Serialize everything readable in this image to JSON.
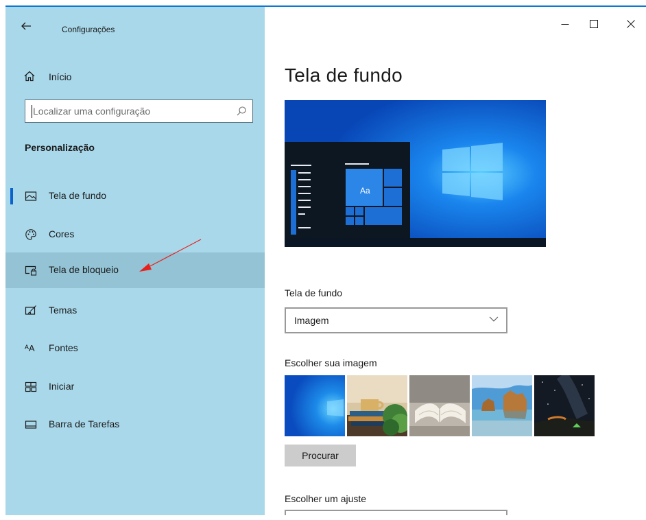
{
  "window": {
    "title": "Configurações",
    "controls": {
      "minimize": "—",
      "maximize": "☐",
      "close": "✕"
    }
  },
  "sidebar": {
    "back_icon": "arrow-left-icon",
    "home": {
      "label": "Início",
      "icon": "home-icon"
    },
    "search": {
      "placeholder": "Localizar uma configuração",
      "icon": "search-icon"
    },
    "section": "Personalização",
    "items": [
      {
        "label": "Tela de fundo",
        "icon": "picture-icon",
        "selected": true
      },
      {
        "label": "Cores",
        "icon": "palette-icon"
      },
      {
        "label": "Tela de bloqueio",
        "icon": "lock-screen-icon",
        "hover": true
      },
      {
        "label": "Temas",
        "icon": "brush-icon"
      },
      {
        "label": "Fontes",
        "icon": "font-icon",
        "glyph": "ᴬA"
      },
      {
        "label": "Iniciar",
        "icon": "start-icon"
      },
      {
        "label": "Barra de Tarefas",
        "icon": "taskbar-icon"
      }
    ]
  },
  "main": {
    "title": "Tela de fundo",
    "preview_tile_text": "Aa",
    "background_label": "Tela de fundo",
    "background_value": "Imagem",
    "choose_image_label": "Escolher sua imagem",
    "browse_button": "Procurar",
    "fit_label": "Escolher um ajuste"
  },
  "colors": {
    "sidebar_bg": "#a9d8ea",
    "accent": "#0a63c9",
    "annotation_arrow": "#e8201c"
  }
}
